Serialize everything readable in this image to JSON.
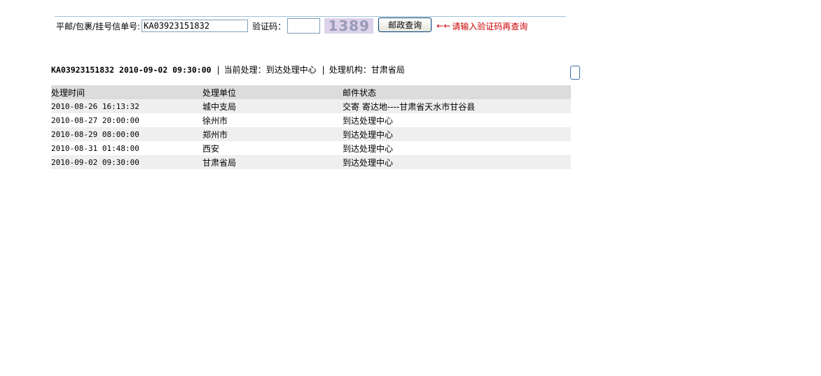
{
  "search": {
    "tracking_label": "平邮/包裹/挂号信单号:",
    "tracking_value": "KA03923151832",
    "captcha_label": "验证码：",
    "captcha_value": "",
    "captcha_image_text": "1389",
    "query_button": "邮政查询",
    "hint_arrow": "←←",
    "hint_text": "请输入验证码再查询"
  },
  "summary": {
    "tracking_id": "KA03923151832",
    "datetime": "2010-09-02 09:30:00",
    "current_label": "当前处理：",
    "current_value": "到达处理中心",
    "org_label": "处理机构：",
    "org_value": "甘肃省局",
    "separator": "|"
  },
  "table": {
    "headers": [
      "处理时间",
      "处理单位",
      "邮件状态"
    ],
    "rows": [
      {
        "time": "2010-08-26 16:13:32",
        "unit": "城中支局",
        "status": "交寄 寄达地----甘肃省天水市甘谷县"
      },
      {
        "time": "2010-08-27 20:00:00",
        "unit": "徐州市",
        "status": "到达处理中心"
      },
      {
        "time": "2010-08-29 08:00:00",
        "unit": "郑州市",
        "status": "到达处理中心"
      },
      {
        "time": "2010-08-31 01:48:00",
        "unit": "西安",
        "status": "到达处理中心"
      },
      {
        "time": "2010-09-02 09:30:00",
        "unit": "甘肃省局",
        "status": "到达处理中心"
      }
    ]
  },
  "colors": {
    "hint": "#cc0000",
    "header_row": "#dcdcdc",
    "stripe_row": "#efefef",
    "captcha_bg": "#dcd3ea"
  }
}
